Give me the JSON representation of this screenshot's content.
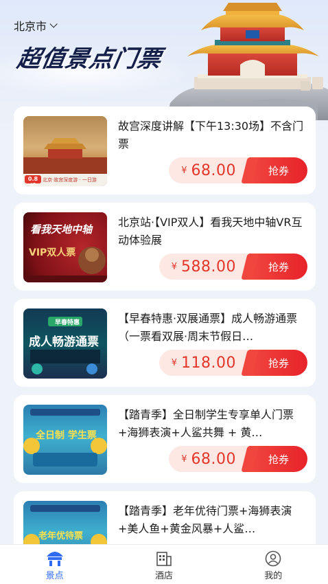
{
  "header": {
    "city": "北京市",
    "banner_title": "超值景点门票"
  },
  "tickets": [
    {
      "title": "故宫深度讲解【下午13:30场】不含门票",
      "currency": "¥",
      "price": "68.00",
      "action": "抢券",
      "thumb_caption": "北京·故宫深度游 · 一日游",
      "thumb_badge": "0.8折"
    },
    {
      "title": "北京站·【VIP双人】看我天地中轴VR互动体验展",
      "currency": "¥",
      "price": "588.00",
      "action": "抢券",
      "thumb_heading": "看我天地中轴",
      "thumb_caption": "VIP双人票"
    },
    {
      "title": "【早春特惠·双展通票】成人畅游通票（一票看双展·周末节假日…",
      "currency": "¥",
      "price": "118.00",
      "action": "抢券",
      "thumb_tag": "早春特惠",
      "thumb_heading": "成人畅游通票"
    },
    {
      "title": "【踏青季】全日制学生专享单人门票+海狮表演+人鲨共舞 + 黄…",
      "currency": "¥",
      "price": "68.00",
      "action": "抢券",
      "thumb_heading": "全日制 学生票"
    },
    {
      "title": "【踏青季】老年优待门票+海狮表演+美人鱼+黄金风暴+人鲨…",
      "currency": "¥",
      "price": "",
      "action": "",
      "thumb_heading": "老年优待票"
    }
  ],
  "tabbar": {
    "tabs": [
      {
        "label": "景点",
        "icon": "attraction-icon",
        "active": true
      },
      {
        "label": "酒店",
        "icon": "hotel-icon",
        "active": false
      },
      {
        "label": "我的",
        "icon": "profile-icon",
        "active": false
      }
    ]
  },
  "colors": {
    "accent": "#e3362a",
    "tab_active": "#2f6bf0",
    "price_bg": "#fde8e4"
  }
}
